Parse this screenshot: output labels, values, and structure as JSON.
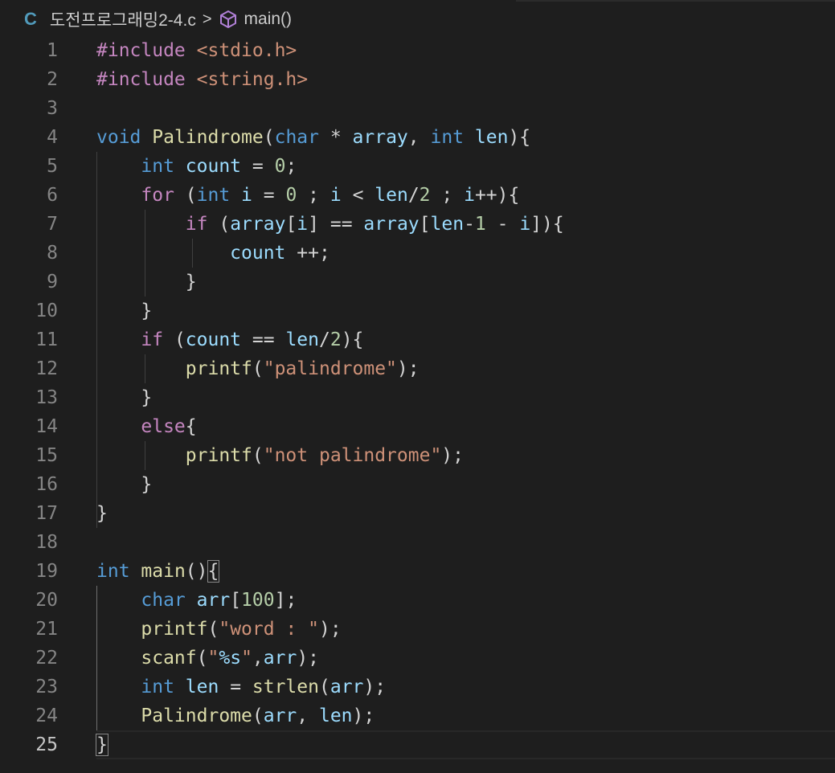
{
  "breadcrumb": {
    "lang": "C",
    "file": "도전프로그래밍2-4.c",
    "separator": ">",
    "symbol_icon": "cube-icon",
    "symbol": "main()"
  },
  "editor": {
    "current_line": 25,
    "lines": [
      {
        "n": "1",
        "tokens": [
          {
            "t": "#include",
            "c": "pp"
          },
          {
            "t": " ",
            "c": "op"
          },
          {
            "t": "<stdio.h>",
            "c": "str"
          }
        ]
      },
      {
        "n": "2",
        "tokens": [
          {
            "t": "#include",
            "c": "pp"
          },
          {
            "t": " ",
            "c": "op"
          },
          {
            "t": "<string.h>",
            "c": "str"
          }
        ]
      },
      {
        "n": "3",
        "tokens": []
      },
      {
        "n": "4",
        "tokens": [
          {
            "t": "void",
            "c": "kw"
          },
          {
            "t": " ",
            "c": "op"
          },
          {
            "t": "Palindrome",
            "c": "fn"
          },
          {
            "t": "(",
            "c": "br"
          },
          {
            "t": "char",
            "c": "kw"
          },
          {
            "t": " * ",
            "c": "op"
          },
          {
            "t": "array",
            "c": "var"
          },
          {
            "t": ", ",
            "c": "op"
          },
          {
            "t": "int",
            "c": "kw"
          },
          {
            "t": " ",
            "c": "op"
          },
          {
            "t": "len",
            "c": "var"
          },
          {
            "t": "){",
            "c": "br"
          }
        ]
      },
      {
        "n": "5",
        "tokens": [
          {
            "t": "    ",
            "c": "op"
          },
          {
            "t": "int",
            "c": "kw"
          },
          {
            "t": " ",
            "c": "op"
          },
          {
            "t": "count",
            "c": "var"
          },
          {
            "t": " = ",
            "c": "op"
          },
          {
            "t": "0",
            "c": "num"
          },
          {
            "t": ";",
            "c": "op"
          }
        ]
      },
      {
        "n": "6",
        "tokens": [
          {
            "t": "    ",
            "c": "op"
          },
          {
            "t": "for",
            "c": "ctl"
          },
          {
            "t": " (",
            "c": "br"
          },
          {
            "t": "int",
            "c": "kw"
          },
          {
            "t": " ",
            "c": "op"
          },
          {
            "t": "i",
            "c": "var"
          },
          {
            "t": " = ",
            "c": "op"
          },
          {
            "t": "0",
            "c": "num"
          },
          {
            "t": " ; ",
            "c": "op"
          },
          {
            "t": "i",
            "c": "var"
          },
          {
            "t": " < ",
            "c": "op"
          },
          {
            "t": "len",
            "c": "var"
          },
          {
            "t": "/",
            "c": "op"
          },
          {
            "t": "2",
            "c": "num"
          },
          {
            "t": " ; ",
            "c": "op"
          },
          {
            "t": "i",
            "c": "var"
          },
          {
            "t": "++){",
            "c": "op"
          }
        ]
      },
      {
        "n": "7",
        "tokens": [
          {
            "t": "        ",
            "c": "op"
          },
          {
            "t": "if",
            "c": "ctl"
          },
          {
            "t": " (",
            "c": "br"
          },
          {
            "t": "array",
            "c": "var"
          },
          {
            "t": "[",
            "c": "br"
          },
          {
            "t": "i",
            "c": "var"
          },
          {
            "t": "] == ",
            "c": "op"
          },
          {
            "t": "array",
            "c": "var"
          },
          {
            "t": "[",
            "c": "br"
          },
          {
            "t": "len",
            "c": "var"
          },
          {
            "t": "-",
            "c": "op"
          },
          {
            "t": "1",
            "c": "num"
          },
          {
            "t": " - ",
            "c": "op"
          },
          {
            "t": "i",
            "c": "var"
          },
          {
            "t": "]){",
            "c": "br"
          }
        ]
      },
      {
        "n": "8",
        "tokens": [
          {
            "t": "            ",
            "c": "op"
          },
          {
            "t": "count",
            "c": "var"
          },
          {
            "t": " ++;",
            "c": "op"
          }
        ]
      },
      {
        "n": "9",
        "tokens": [
          {
            "t": "        }",
            "c": "br"
          }
        ]
      },
      {
        "n": "10",
        "tokens": [
          {
            "t": "    }",
            "c": "br"
          }
        ]
      },
      {
        "n": "11",
        "tokens": [
          {
            "t": "    ",
            "c": "op"
          },
          {
            "t": "if",
            "c": "ctl"
          },
          {
            "t": " (",
            "c": "br"
          },
          {
            "t": "count",
            "c": "var"
          },
          {
            "t": " == ",
            "c": "op"
          },
          {
            "t": "len",
            "c": "var"
          },
          {
            "t": "/",
            "c": "op"
          },
          {
            "t": "2",
            "c": "num"
          },
          {
            "t": "){",
            "c": "br"
          }
        ]
      },
      {
        "n": "12",
        "tokens": [
          {
            "t": "        ",
            "c": "op"
          },
          {
            "t": "printf",
            "c": "fn"
          },
          {
            "t": "(",
            "c": "br"
          },
          {
            "t": "\"palindrome\"",
            "c": "str"
          },
          {
            "t": ");",
            "c": "op"
          }
        ]
      },
      {
        "n": "13",
        "tokens": [
          {
            "t": "    }",
            "c": "br"
          }
        ]
      },
      {
        "n": "14",
        "tokens": [
          {
            "t": "    ",
            "c": "op"
          },
          {
            "t": "else",
            "c": "ctl"
          },
          {
            "t": "{",
            "c": "br"
          }
        ]
      },
      {
        "n": "15",
        "tokens": [
          {
            "t": "        ",
            "c": "op"
          },
          {
            "t": "printf",
            "c": "fn"
          },
          {
            "t": "(",
            "c": "br"
          },
          {
            "t": "\"not palindrome\"",
            "c": "str"
          },
          {
            "t": ");",
            "c": "op"
          }
        ]
      },
      {
        "n": "16",
        "tokens": [
          {
            "t": "    }",
            "c": "br"
          }
        ]
      },
      {
        "n": "17",
        "tokens": [
          {
            "t": "}",
            "c": "br"
          }
        ]
      },
      {
        "n": "18",
        "tokens": []
      },
      {
        "n": "19",
        "tokens": [
          {
            "t": "int",
            "c": "kw"
          },
          {
            "t": " ",
            "c": "op"
          },
          {
            "t": "main",
            "c": "fn"
          },
          {
            "t": "()",
            "c": "br"
          },
          {
            "t": "{",
            "c": "brm"
          }
        ]
      },
      {
        "n": "20",
        "tokens": [
          {
            "t": "    ",
            "c": "op"
          },
          {
            "t": "char",
            "c": "kw"
          },
          {
            "t": " ",
            "c": "op"
          },
          {
            "t": "arr",
            "c": "var"
          },
          {
            "t": "[",
            "c": "br"
          },
          {
            "t": "100",
            "c": "num"
          },
          {
            "t": "];",
            "c": "op"
          }
        ]
      },
      {
        "n": "21",
        "tokens": [
          {
            "t": "    ",
            "c": "op"
          },
          {
            "t": "printf",
            "c": "fn"
          },
          {
            "t": "(",
            "c": "br"
          },
          {
            "t": "\"word : \"",
            "c": "str"
          },
          {
            "t": ");",
            "c": "op"
          }
        ]
      },
      {
        "n": "22",
        "tokens": [
          {
            "t": "    ",
            "c": "op"
          },
          {
            "t": "scanf",
            "c": "fn"
          },
          {
            "t": "(",
            "c": "br"
          },
          {
            "t": "\"",
            "c": "str"
          },
          {
            "t": "%s",
            "c": "esc"
          },
          {
            "t": "\"",
            "c": "str"
          },
          {
            "t": ",",
            "c": "op"
          },
          {
            "t": "arr",
            "c": "var"
          },
          {
            "t": ");",
            "c": "op"
          }
        ]
      },
      {
        "n": "23",
        "tokens": [
          {
            "t": "    ",
            "c": "op"
          },
          {
            "t": "int",
            "c": "kw"
          },
          {
            "t": " ",
            "c": "op"
          },
          {
            "t": "len",
            "c": "var"
          },
          {
            "t": " = ",
            "c": "op"
          },
          {
            "t": "strlen",
            "c": "fn"
          },
          {
            "t": "(",
            "c": "br"
          },
          {
            "t": "arr",
            "c": "var"
          },
          {
            "t": ");",
            "c": "op"
          }
        ]
      },
      {
        "n": "24",
        "tokens": [
          {
            "t": "    ",
            "c": "op"
          },
          {
            "t": "Palindrome",
            "c": "fn"
          },
          {
            "t": "(",
            "c": "br"
          },
          {
            "t": "arr",
            "c": "var"
          },
          {
            "t": ", ",
            "c": "op"
          },
          {
            "t": "len",
            "c": "var"
          },
          {
            "t": ");",
            "c": "op"
          }
        ]
      },
      {
        "n": "25",
        "tokens": [
          {
            "t": "}",
            "c": "brm"
          }
        ]
      }
    ]
  },
  "colors": {
    "background": "#1e1e1e",
    "line_number": "#858585",
    "keyword": "#569cd6",
    "control": "#c586c0",
    "function": "#dcdcaa",
    "variable": "#9cdcfe",
    "string": "#ce9178",
    "number": "#b5cea8"
  }
}
